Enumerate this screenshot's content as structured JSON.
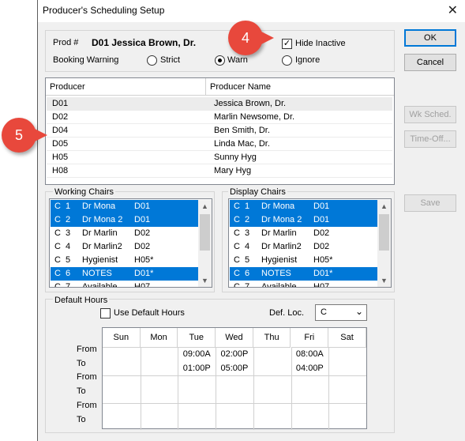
{
  "window": {
    "title": "Producer's Scheduling Setup",
    "close": "✕"
  },
  "prod": {
    "label": "Prod #",
    "value": "D01 Jessica Brown, Dr."
  },
  "booking": {
    "label": "Booking Warning",
    "options": [
      "Strict",
      "Warn",
      "Ignore"
    ],
    "selected": "Warn"
  },
  "hide_inactive": {
    "label": "Hide Inactive",
    "checked": true,
    "mark": "✓"
  },
  "buttons": {
    "ok": "OK",
    "cancel": "Cancel",
    "wk_sched": "Wk Sched.",
    "time_off": "Time-Off...",
    "save": "Save"
  },
  "producers": {
    "headers": [
      "Producer",
      "Producer Name"
    ],
    "rows": [
      [
        "D01",
        "Jessica Brown, Dr."
      ],
      [
        "D02",
        "Marlin Newsome, Dr."
      ],
      [
        "D04",
        "Ben Smith, Dr."
      ],
      [
        "D05",
        "Linda Mac, Dr."
      ],
      [
        "H05",
        "Sunny Hyg"
      ],
      [
        "H08",
        "Mary Hyg"
      ]
    ]
  },
  "working_chairs": {
    "label": "Working Chairs",
    "rows": [
      [
        "C",
        "1",
        "Dr Mona",
        "D01"
      ],
      [
        "C",
        "2",
        "Dr Mona 2",
        "D01"
      ],
      [
        "C",
        "3",
        "Dr Marlin",
        "D02"
      ],
      [
        "C",
        "4",
        "Dr Marlin2",
        "D02"
      ],
      [
        "C",
        "5",
        "Hygienist",
        "H05*"
      ],
      [
        "C",
        "6",
        "NOTES",
        "D01*"
      ],
      [
        "C",
        "7",
        "Available",
        "H07"
      ]
    ],
    "selected": [
      0,
      1,
      5
    ]
  },
  "display_chairs": {
    "label": "Display Chairs",
    "rows": [
      [
        "C",
        "1",
        "Dr Mona",
        "D01"
      ],
      [
        "C",
        "2",
        "Dr Mona 2",
        "D01"
      ],
      [
        "C",
        "3",
        "Dr Marlin",
        "D02"
      ],
      [
        "C",
        "4",
        "Dr Marlin2",
        "D02"
      ],
      [
        "C",
        "5",
        "Hygienist",
        "H05*"
      ],
      [
        "C",
        "6",
        "NOTES",
        "D01*"
      ],
      [
        "C",
        "7",
        "Available",
        "H07"
      ]
    ],
    "selected": [
      0,
      1,
      5
    ]
  },
  "default_hours": {
    "label": "Default Hours",
    "use_default_label": "Use Default Hours",
    "use_default_checked": false,
    "def_loc_label": "Def. Loc.",
    "def_loc_value": "C",
    "days": [
      "Sun",
      "Mon",
      "Tue",
      "Wed",
      "Thu",
      "Fri",
      "Sat"
    ],
    "row_labels": [
      "From",
      "To",
      "From",
      "To",
      "From",
      "To"
    ],
    "hours": {
      "Tue": [
        "09:00A",
        "01:00P"
      ],
      "Wed": [
        "02:00P",
        "05:00P"
      ],
      "Fri": [
        "08:00A",
        "04:00P"
      ]
    }
  },
  "callouts": [
    "4",
    "5"
  ],
  "colors": {
    "selection": "#0078d7",
    "callout": "#e8483c",
    "accent": "#0078d7"
  }
}
